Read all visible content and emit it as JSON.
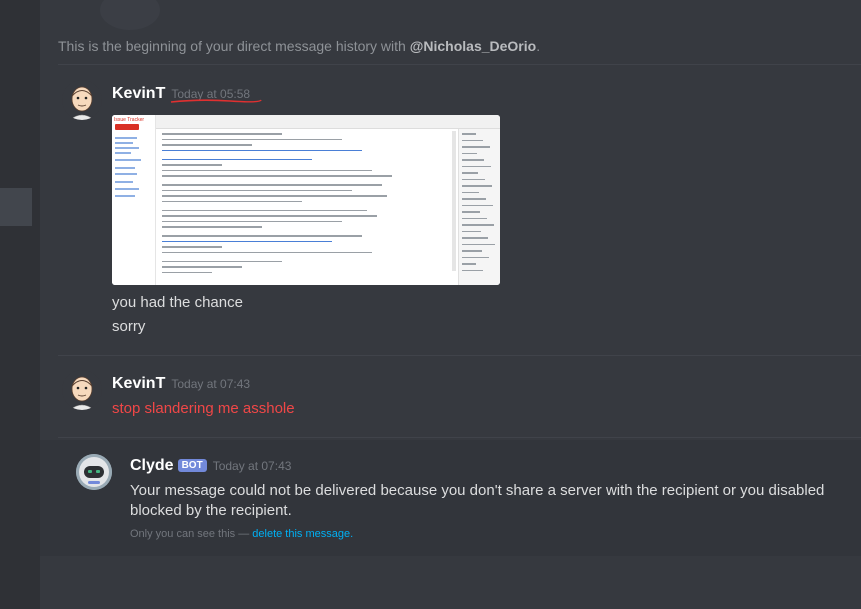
{
  "history": {
    "prefix": "This is the beginning of your direct message history with ",
    "user": "@Nicholas_DeOrio",
    "suffix": "."
  },
  "messages": [
    {
      "author": "KevinT",
      "timestamp": "Today at 05:58",
      "lines": [
        "you had the chance",
        "sorry"
      ]
    },
    {
      "author": "KevinT",
      "timestamp": "Today at 07:43",
      "lines": [
        "stop slandering me asshole"
      ],
      "text_color": "#f04747"
    }
  ],
  "clyde": {
    "author": "Clyde",
    "bot_tag": "BOT",
    "timestamp": "Today at 07:43",
    "line1": "Your message could not be delivered because you don't share a server with the recipient or you disabled",
    "line2": "blocked by the recipient.",
    "note_prefix": "Only you can see this — ",
    "note_link": "delete this message."
  },
  "attachment": {
    "app_title": "Issue Tracker",
    "create_label": "CREATE ISSUE"
  },
  "colors": {
    "background": "#36393f",
    "rail": "#2f3136",
    "danger": "#f04747",
    "link": "#00b0f4",
    "bot_tag": "#7289da"
  }
}
